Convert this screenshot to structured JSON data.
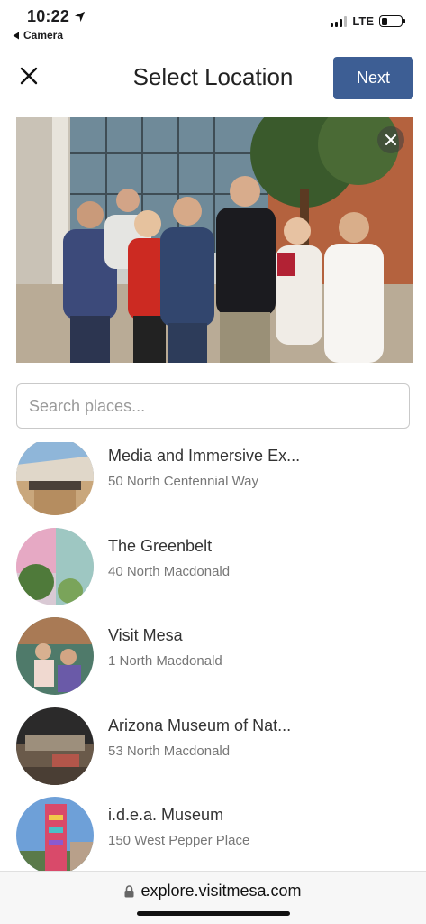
{
  "status_bar": {
    "time": "10:22",
    "back_app": "Camera",
    "network": "LTE",
    "battery_level": 0.3
  },
  "header": {
    "title": "Select Location",
    "next_label": "Next"
  },
  "search": {
    "placeholder": "Search places..."
  },
  "places": [
    {
      "name": "Media and Immersive Ex...",
      "address": "50 North Centennial Way"
    },
    {
      "name": "The Greenbelt",
      "address": "40 North Macdonald"
    },
    {
      "name": "Visit Mesa",
      "address": "1 North Macdonald"
    },
    {
      "name": "Arizona Museum of Nat...",
      "address": "53 North Macdonald"
    },
    {
      "name": "i.d.e.a. Museum",
      "address": "150 West Pepper Place"
    }
  ],
  "browser": {
    "url": "explore.visitmesa.com"
  },
  "colors": {
    "accent": "#3d5e94"
  }
}
